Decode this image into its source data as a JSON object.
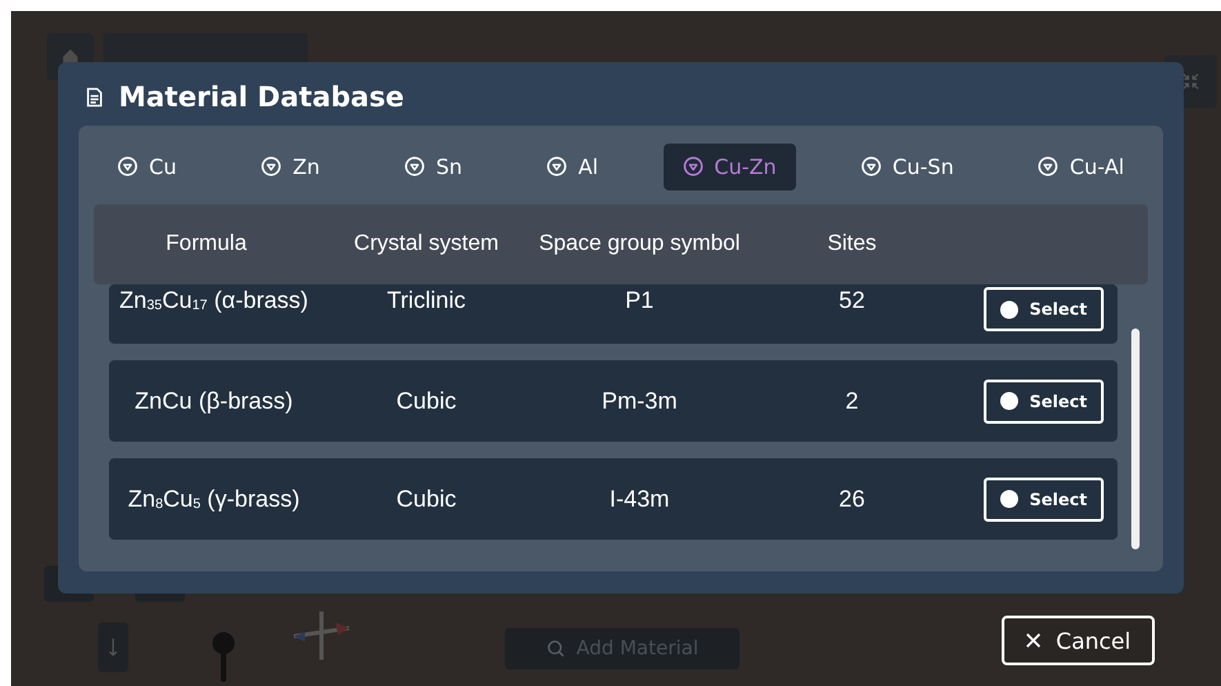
{
  "background": {
    "add_material_button": {
      "label": "Add Material"
    }
  },
  "dialog": {
    "title": "Material Database",
    "tabs": [
      {
        "label": "Cu",
        "selected": false
      },
      {
        "label": "Zn",
        "selected": false
      },
      {
        "label": "Sn",
        "selected": false
      },
      {
        "label": "Al",
        "selected": false
      },
      {
        "label": "Cu-Zn",
        "selected": true
      },
      {
        "label": "Cu-Sn",
        "selected": false
      },
      {
        "label": "Cu-Al",
        "selected": false
      }
    ],
    "columns": [
      "Formula",
      "Crystal system",
      "Space group symbol",
      "Sites"
    ],
    "rows": [
      {
        "formula": "Zn$_{35}$Cu$_{17}$ (α-brass)",
        "crystal_system": "Triclinic",
        "space_group": "P1",
        "sites": "52",
        "action": "Select"
      },
      {
        "formula": "ZnCu (β-brass)",
        "crystal_system": "Cubic",
        "space_group": "Pm-3m",
        "sites": "2",
        "action": "Select"
      },
      {
        "formula": "Zn$_{8}$Cu$_{5}$ (γ-brass)",
        "crystal_system": "Cubic",
        "space_group": "I-43m",
        "sites": "26",
        "action": "Select"
      }
    ]
  },
  "cancel_button": {
    "label": "Cancel"
  }
}
